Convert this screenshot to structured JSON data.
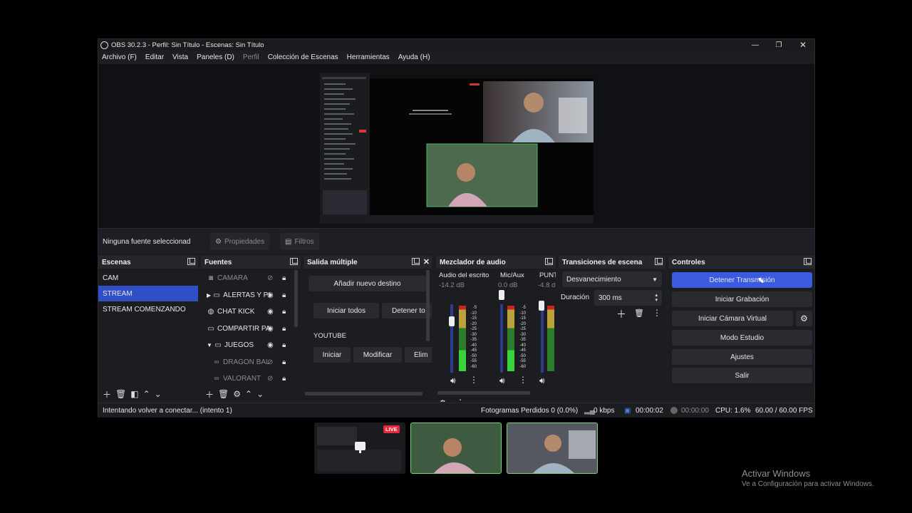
{
  "window": {
    "title": "OBS 30.2.3 - Perfil: Sin Título - Escenas: Sin Título"
  },
  "menu": [
    "Archivo (F)",
    "Editar",
    "Vista",
    "Paneles (D)",
    "Perfil",
    "Colección de Escenas",
    "Herramientas",
    "Ayuda (H)"
  ],
  "source_bar": {
    "label": "Ninguna fuente seleccionad",
    "properties": "Propiedades",
    "filters": "Filtros"
  },
  "scenes": {
    "title": "Escenas",
    "items": [
      "CAM",
      "STREAM",
      "STREAM COMENZANDO"
    ],
    "selected": "STREAM"
  },
  "sources": {
    "title": "Fuentes",
    "items": [
      {
        "label": "CAMARA",
        "icon": "camera-icon",
        "dim": true
      },
      {
        "label": "ALERTAS Y PI",
        "icon": "folder-icon",
        "dim": false
      },
      {
        "label": "CHAT KICK",
        "icon": "browser-icon",
        "dim": false
      },
      {
        "label": "COMPARTIR PA",
        "icon": "monitor-icon",
        "dim": false
      },
      {
        "label": "JUEGOS",
        "icon": "folder-icon",
        "dim": false
      },
      {
        "label": "DRAGON BAL",
        "icon": "gamepad-icon",
        "dim": true
      },
      {
        "label": "VALORANT",
        "icon": "gamepad-icon",
        "dim": true
      }
    ]
  },
  "multi_output": {
    "title": "Salida múltiple",
    "add_destination": "Añadir nuevo destino",
    "start_all": "Iniciar todos",
    "stop_all": "Detener to",
    "platform": "YOUTUBE",
    "start": "Iniciar",
    "modify": "Modificar",
    "delete": "Elim"
  },
  "audio_mixer": {
    "title": "Mezclador de audio",
    "channels": [
      {
        "name": "Audio del escrito",
        "db": "-14.2 dB"
      },
      {
        "name": "Mic/Aux",
        "db": "0.0 dB"
      },
      {
        "name": "PUNT",
        "db": "-4.8 d"
      }
    ],
    "ticks": [
      "-5",
      "-10",
      "-15",
      "-20",
      "-25",
      "-30",
      "-35",
      "-40",
      "-45",
      "-50",
      "-55",
      "-60"
    ]
  },
  "transitions": {
    "title": "Transiciones de escena",
    "type": "Desvanecimiento",
    "duration_label": "Duración",
    "duration_value": "300 ms"
  },
  "controls": {
    "title": "Controles",
    "stop_stream": "Detener Transmisión",
    "start_recording": "Iniciar Grabación",
    "virtual_cam": "Iniciar Cámara Virtual",
    "studio_mode": "Modo Estudio",
    "settings": "Ajustes",
    "exit": "Salir"
  },
  "status": {
    "message": "Intentando volver a conectar... (intento 1)",
    "dropped_frames": "Fotogramas Perdidos 0 (0.0%)",
    "bitrate": "0 kbps",
    "stream_time": "00:00:02",
    "record_time": "00:00:00",
    "cpu": "CPU: 1.6%",
    "fps": "60.00 / 60.00 FPS"
  },
  "taskbar_preview": {
    "live_badge": "LIVE"
  },
  "watermark": {
    "title": "Activar Windows",
    "subtitle": "Ve a Configuración para activar Windows."
  },
  "colors": {
    "accent": "#3a5be0",
    "live": "#e8283a",
    "meter_green": "#39d43a"
  }
}
